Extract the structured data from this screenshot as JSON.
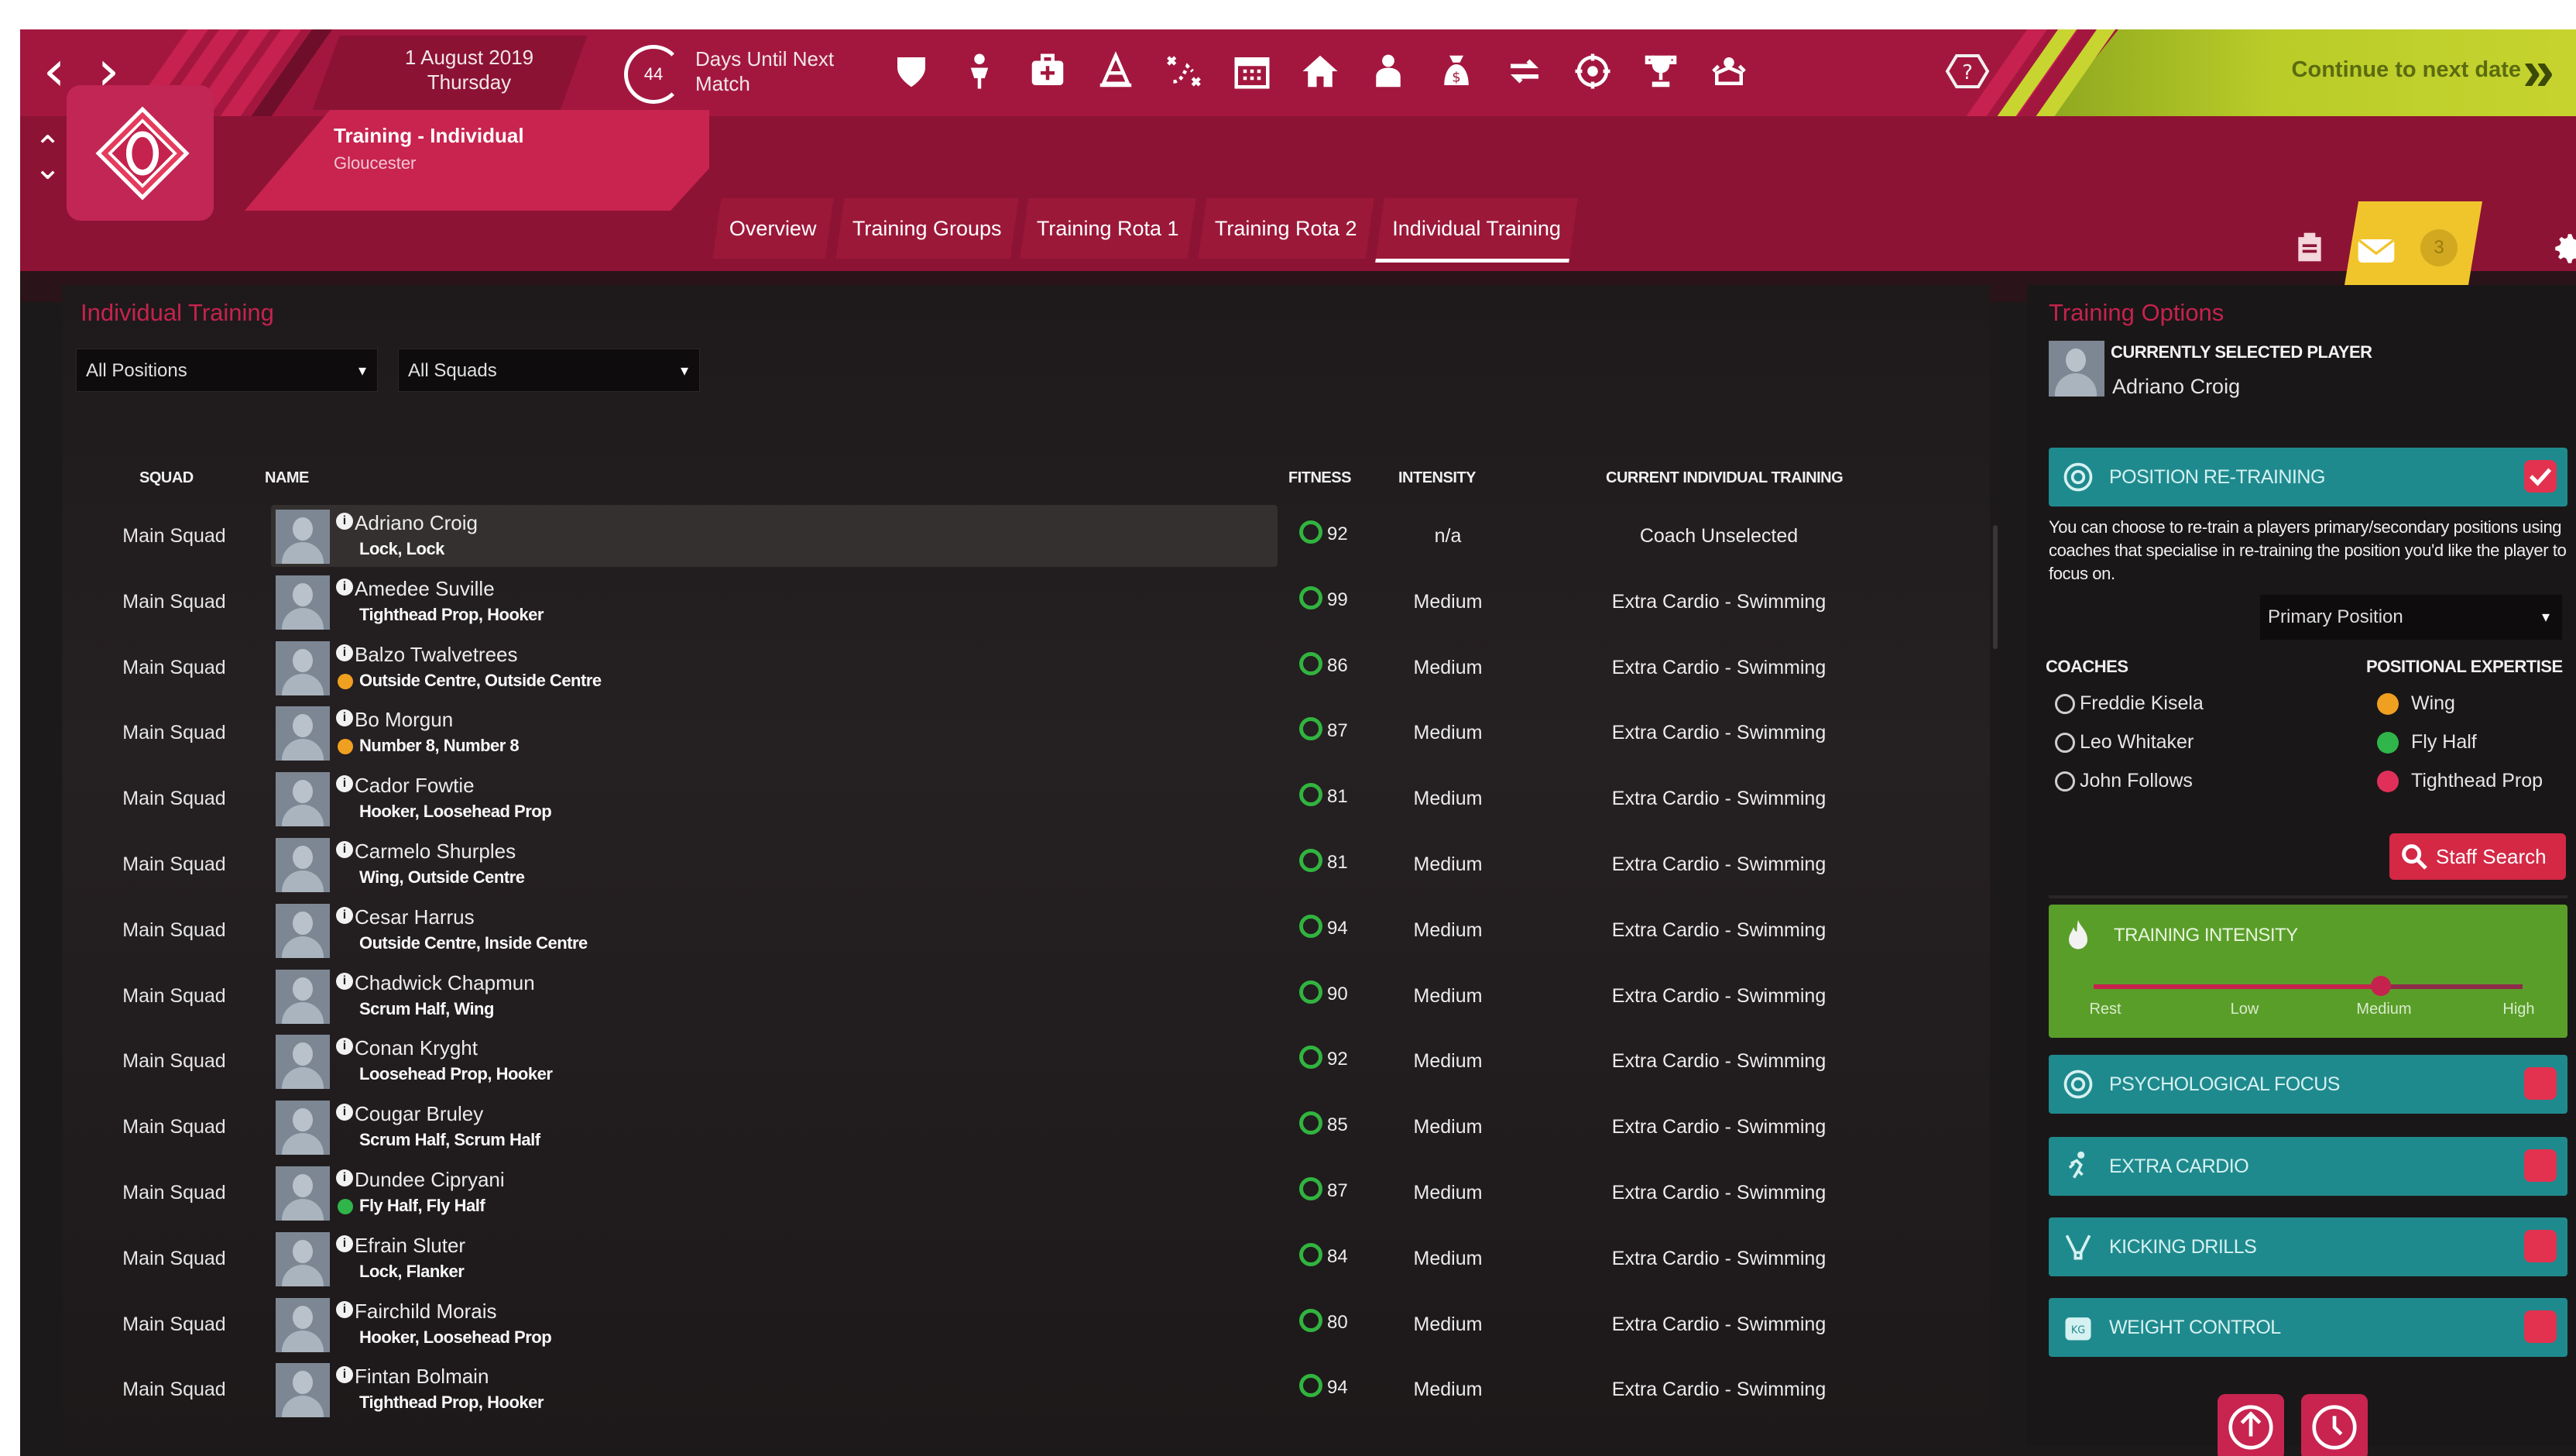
{
  "header": {
    "date": "1 August 2019",
    "day": "Thursday",
    "days_until_label_1": "Days Until Next",
    "days_until_label_2": "Match",
    "days_value": "44",
    "continue_label": "Continue to next date"
  },
  "subheader": {
    "title": "Training - Individual",
    "subtitle": "Gloucester",
    "tabs": [
      "Overview",
      "Training Groups",
      "Training Rota 1",
      "Training Rota 2",
      "Individual Training"
    ],
    "active_tab": "Individual Training",
    "mail_count": "3"
  },
  "left": {
    "title": "Individual Training",
    "position_filter": "All Positions",
    "squad_filter": "All Squads",
    "columns": {
      "squad": "SQUAD",
      "name": "NAME",
      "fitness": "FITNESS",
      "intensity": "INTENSITY",
      "current": "CURRENT INDIVIDUAL TRAINING"
    },
    "rows": [
      {
        "squad": "Main Squad",
        "name": "Adriano Croig",
        "positions": "Lock, Lock",
        "fitness": "92",
        "intensity": "n/a",
        "training": "Coach Unselected",
        "dot": ""
      },
      {
        "squad": "Main Squad",
        "name": "Amedee Suville",
        "positions": "Tighthead Prop, Hooker",
        "fitness": "99",
        "intensity": "Medium",
        "training": "Extra Cardio - Swimming",
        "dot": ""
      },
      {
        "squad": "Main Squad",
        "name": "Balzo Twalvetrees",
        "positions": "Outside Centre, Outside Centre",
        "fitness": "86",
        "intensity": "Medium",
        "training": "Extra Cardio - Swimming",
        "dot": "#f0a020"
      },
      {
        "squad": "Main Squad",
        "name": "Bo Morgun",
        "positions": "Number 8, Number 8",
        "fitness": "87",
        "intensity": "Medium",
        "training": "Extra Cardio - Swimming",
        "dot": "#f0a020"
      },
      {
        "squad": "Main Squad",
        "name": "Cador Fowtie",
        "positions": "Hooker, Loosehead Prop",
        "fitness": "81",
        "intensity": "Medium",
        "training": "Extra Cardio - Swimming",
        "dot": ""
      },
      {
        "squad": "Main Squad",
        "name": "Carmelo Shurples",
        "positions": "Wing, Outside Centre",
        "fitness": "81",
        "intensity": "Medium",
        "training": "Extra Cardio - Swimming",
        "dot": ""
      },
      {
        "squad": "Main Squad",
        "name": "Cesar Harrus",
        "positions": "Outside Centre, Inside Centre",
        "fitness": "94",
        "intensity": "Medium",
        "training": "Extra Cardio - Swimming",
        "dot": ""
      },
      {
        "squad": "Main Squad",
        "name": "Chadwick Chapmun",
        "positions": "Scrum Half, Wing",
        "fitness": "90",
        "intensity": "Medium",
        "training": "Extra Cardio - Swimming",
        "dot": ""
      },
      {
        "squad": "Main Squad",
        "name": "Conan Kryght",
        "positions": "Loosehead Prop, Hooker",
        "fitness": "92",
        "intensity": "Medium",
        "training": "Extra Cardio - Swimming",
        "dot": ""
      },
      {
        "squad": "Main Squad",
        "name": "Cougar Bruley",
        "positions": "Scrum Half, Scrum Half",
        "fitness": "85",
        "intensity": "Medium",
        "training": "Extra Cardio - Swimming",
        "dot": ""
      },
      {
        "squad": "Main Squad",
        "name": "Dundee Cipryani",
        "positions": "Fly Half, Fly Half",
        "fitness": "87",
        "intensity": "Medium",
        "training": "Extra Cardio - Swimming",
        "dot": "#2fb54a"
      },
      {
        "squad": "Main Squad",
        "name": "Efrain Sluter",
        "positions": "Lock, Flanker",
        "fitness": "84",
        "intensity": "Medium",
        "training": "Extra Cardio - Swimming",
        "dot": ""
      },
      {
        "squad": "Main Squad",
        "name": "Fairchild Morais",
        "positions": "Hooker, Loosehead Prop",
        "fitness": "80",
        "intensity": "Medium",
        "training": "Extra Cardio - Swimming",
        "dot": ""
      },
      {
        "squad": "Main Squad",
        "name": "Fintan Bolmain",
        "positions": "Tighthead Prop, Hooker",
        "fitness": "94",
        "intensity": "Medium",
        "training": "Extra Cardio - Swimming",
        "dot": ""
      }
    ]
  },
  "right": {
    "title": "Training Options",
    "selected_label": "CURRENTLY SELECTED PLAYER",
    "selected_name": "Adriano Croig",
    "retraining_label": "POSITION RE-TRAINING",
    "retraining_desc": "You can choose to re-train a players primary/secondary positions using coaches that specialise in re-training the position you'd like the player to focus on.",
    "position_select": "Primary Position",
    "coaches_head": "COACHES",
    "expertise_head": "POSITIONAL EXPERTISE",
    "coaches": [
      "Freddie Kisela",
      "Leo Whitaker",
      "John Follows"
    ],
    "expertise": [
      {
        "label": "Wing",
        "color": "#f0a020"
      },
      {
        "label": "Fly Half",
        "color": "#2fb54a"
      },
      {
        "label": "Tighthead Prop",
        "color": "#e0305a"
      }
    ],
    "staff_search": "Staff Search",
    "intensity_label": "TRAINING INTENSITY",
    "intensity_levels": [
      "Rest",
      "Low",
      "Medium",
      "High"
    ],
    "intensity_value": 0.67,
    "options": [
      {
        "label": "PSYCHOLOGICAL FOCUS"
      },
      {
        "label": "EXTRA CARDIO"
      },
      {
        "label": "KICKING DRILLS"
      },
      {
        "label": "WEIGHT CONTROL"
      }
    ]
  },
  "colors": {
    "brand": "#a3173f",
    "accent": "#c5234d",
    "teal": "#1f8a8e",
    "green": "#5a9e2a",
    "yellow": "#c8d430"
  }
}
